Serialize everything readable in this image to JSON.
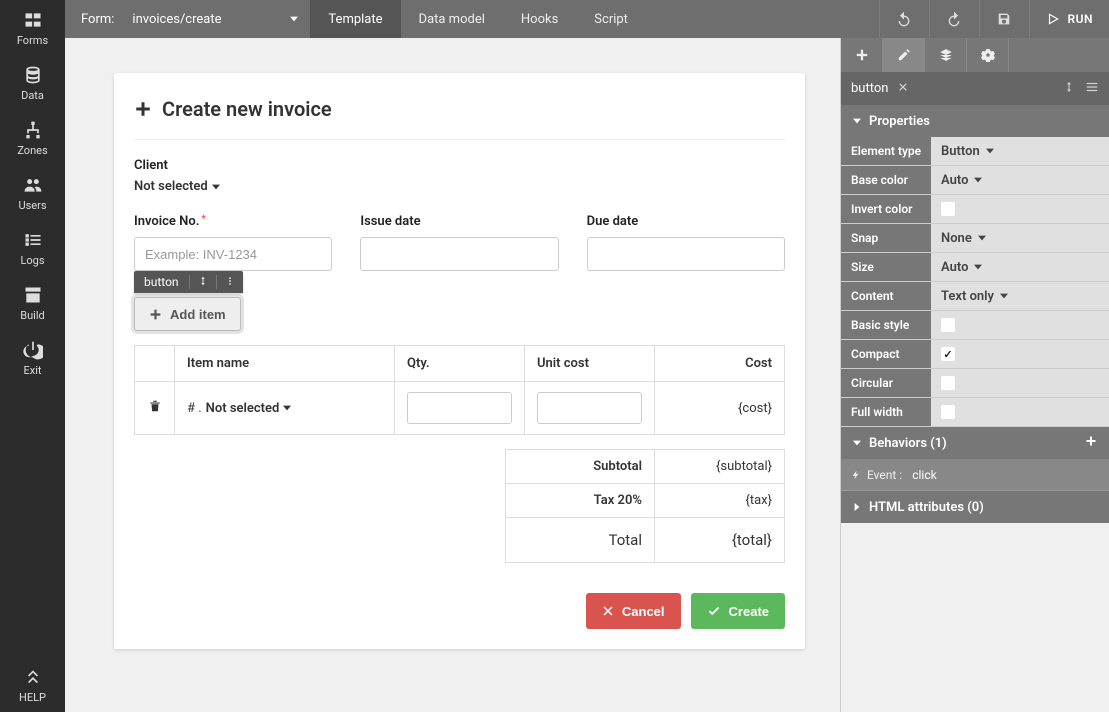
{
  "topbar": {
    "form_label": "Form:",
    "form_name": "invoices/create",
    "tabs": [
      "Template",
      "Data model",
      "Hooks",
      "Script"
    ],
    "run_label": "RUN"
  },
  "sidebar": {
    "items": [
      {
        "label": "Forms"
      },
      {
        "label": "Data"
      },
      {
        "label": "Zones"
      },
      {
        "label": "Users"
      },
      {
        "label": "Logs"
      },
      {
        "label": "Build"
      },
      {
        "label": "Exit"
      }
    ],
    "help_label": "HELP"
  },
  "card": {
    "title": "Create new invoice",
    "client_label": "Client",
    "client_value": "Not selected",
    "invoice_no_label": "Invoice No.",
    "invoice_no_placeholder": "Example: INV-1234",
    "issue_date_label": "Issue date",
    "due_date_label": "Due date",
    "selected_badge": "button",
    "add_item_label": "Add item",
    "table": {
      "cols": [
        "Item name",
        "Qty.",
        "Unit cost",
        "Cost"
      ],
      "row_prefix": "# .",
      "row_name": "Not selected",
      "row_cost": "{cost}"
    },
    "summary": {
      "subtotal_label": "Subtotal",
      "subtotal_value": "{subtotal}",
      "tax_label": "Tax 20%",
      "tax_value": "{tax}",
      "total_label": "Total",
      "total_value": "{total}"
    },
    "cancel_label": "Cancel",
    "create_label": "Create"
  },
  "rpanel": {
    "crumb_label": "button",
    "sections": {
      "properties": "Properties",
      "behaviors": "Behaviors (1)",
      "attrs": "HTML attributes (0)"
    },
    "props": {
      "element_type": {
        "label": "Element type",
        "value": "Button"
      },
      "base_color": {
        "label": "Base color",
        "value": "Auto"
      },
      "invert_color": {
        "label": "Invert color",
        "checked": false
      },
      "snap": {
        "label": "Snap",
        "value": "None"
      },
      "size": {
        "label": "Size",
        "value": "Auto"
      },
      "content": {
        "label": "Content",
        "value": "Text only"
      },
      "basic_style": {
        "label": "Basic style",
        "checked": false
      },
      "compact": {
        "label": "Compact",
        "checked": true
      },
      "circular": {
        "label": "Circular",
        "checked": false
      },
      "full_width": {
        "label": "Full width",
        "checked": false
      }
    },
    "event_prefix": "Event :",
    "event_value": "click"
  }
}
